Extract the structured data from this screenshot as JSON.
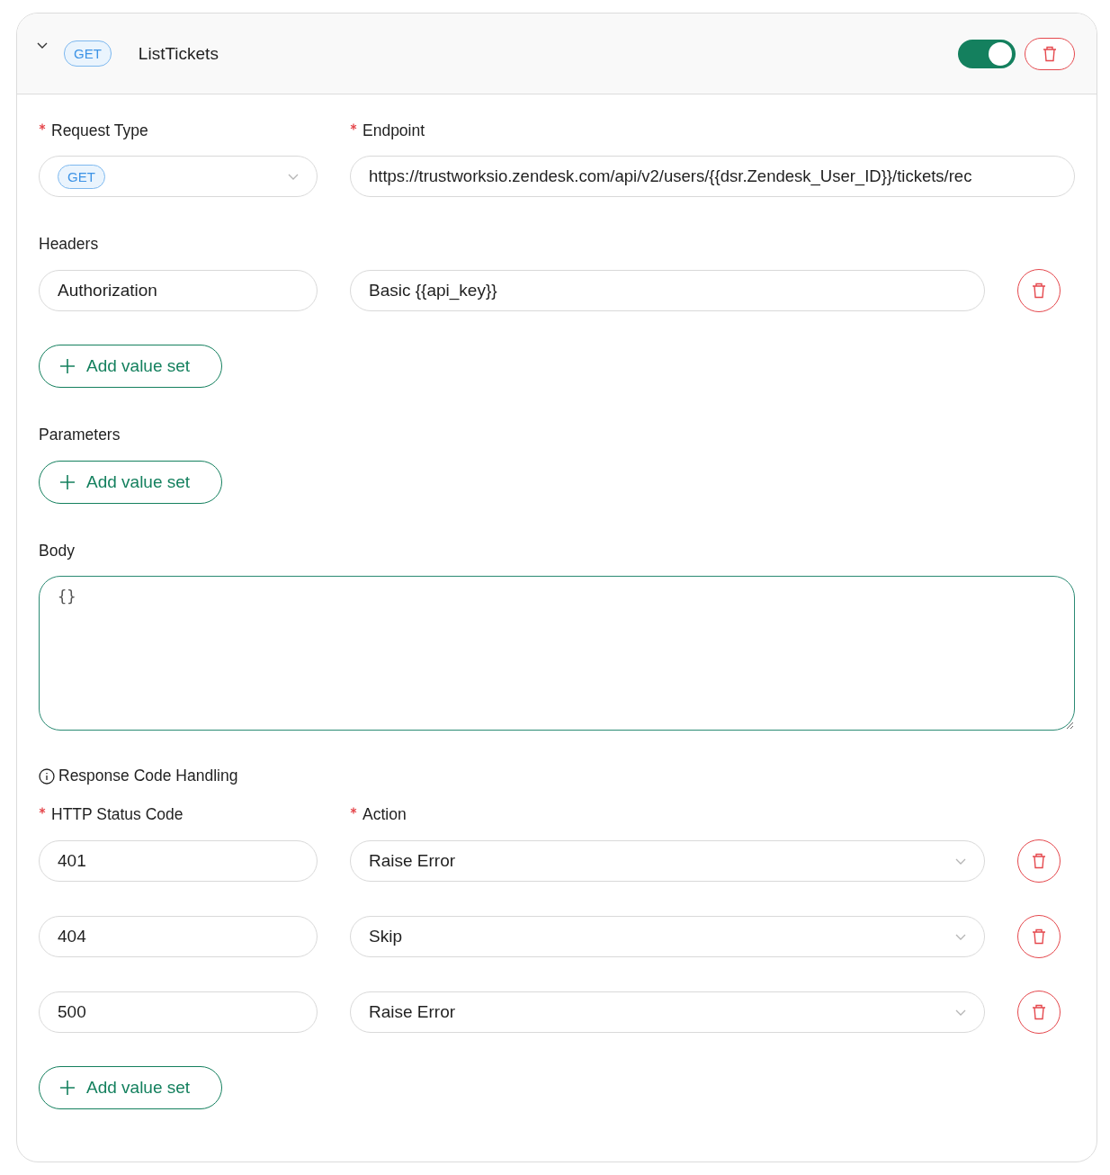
{
  "endpoint_card": {
    "expanded": true,
    "method_badge": "GET",
    "name": "ListTickets",
    "enabled": true
  },
  "request_type": {
    "label": "Request Type",
    "required": true,
    "value": "GET"
  },
  "endpoint": {
    "label": "Endpoint",
    "required": true,
    "value": "https://trustworksio.zendesk.com/api/v2/users/{{dsr.Zendesk_User_ID}}/tickets/rec"
  },
  "headers": {
    "label": "Headers",
    "rows": [
      {
        "key": "Authorization",
        "value": "Basic {{api_key}}"
      }
    ],
    "add_button": "Add value set"
  },
  "parameters": {
    "label": "Parameters",
    "add_button": "Add value set"
  },
  "body": {
    "label": "Body",
    "value": "{}"
  },
  "response_code_handling": {
    "title": "Response Code Handling",
    "status_label": "HTTP Status Code",
    "status_required": true,
    "action_label": "Action",
    "action_required": true,
    "rows": [
      {
        "status": "401",
        "action": "Raise Error"
      },
      {
        "status": "404",
        "action": "Skip"
      },
      {
        "status": "500",
        "action": "Raise Error"
      }
    ],
    "add_button": "Add value set"
  }
}
